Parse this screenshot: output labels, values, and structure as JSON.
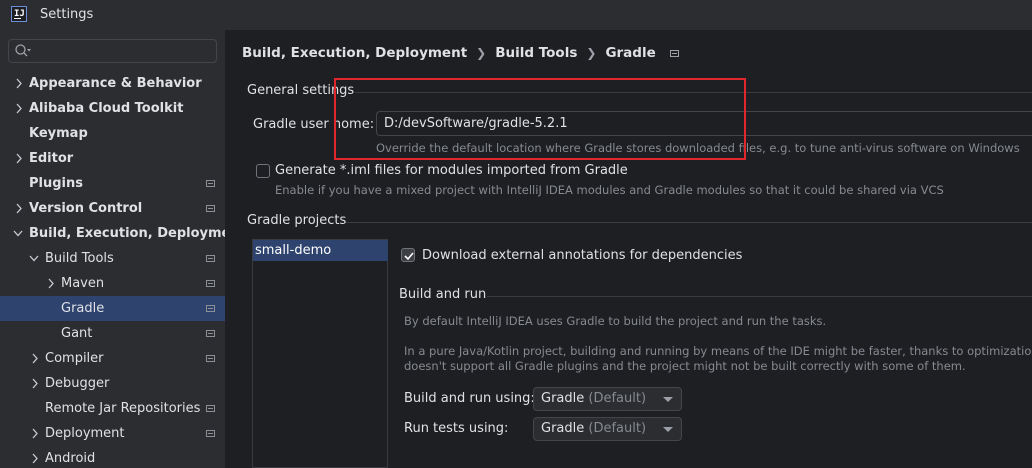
{
  "window": {
    "logo_text": "IJ",
    "title": "Settings"
  },
  "sidebar": {
    "search_placeholder": "",
    "items": [
      {
        "label": "Appearance & Behavior"
      },
      {
        "label": "Alibaba Cloud Toolkit"
      },
      {
        "label": "Keymap"
      },
      {
        "label": "Editor"
      },
      {
        "label": "Plugins"
      },
      {
        "label": "Version Control"
      },
      {
        "label": "Build, Execution, Deployment"
      },
      {
        "label": "Build Tools"
      },
      {
        "label": "Maven"
      },
      {
        "label": "Gradle"
      },
      {
        "label": "Gant"
      },
      {
        "label": "Compiler"
      },
      {
        "label": "Debugger"
      },
      {
        "label": "Remote Jar Repositories"
      },
      {
        "label": "Deployment"
      },
      {
        "label": "Android"
      }
    ]
  },
  "breadcrumb": {
    "items": [
      "Build, Execution, Deployment",
      "Build Tools",
      "Gradle"
    ]
  },
  "general": {
    "title": "General settings",
    "user_home_label": "Gradle user home:",
    "user_home_value": "D:/devSoftware/gradle-5.2.1",
    "user_home_hint": "Override the default location where Gradle stores downloaded files, e.g. to tune anti-virus software on Windows",
    "generate_iml_label": "Generate *.iml files for modules imported from Gradle",
    "generate_iml_checked": false,
    "generate_iml_hint": "Enable if you have a mixed project with IntelliJ IDEA modules and Gradle modules so that it could be shared via VCS"
  },
  "projects": {
    "title": "Gradle projects",
    "list": [
      "small-demo"
    ],
    "download_annotations_label": "Download external annotations for dependencies",
    "download_annotations_checked": true
  },
  "build_and_run": {
    "title": "Build and run",
    "desc1": "By default IntelliJ IDEA uses Gradle to build the project and run the tasks.",
    "desc2_line1": "In a pure Java/Kotlin project, building and running by means of the IDE might be faster, thanks to optimizations. Note, tha",
    "desc2_line2": "doesn't support all Gradle plugins and the project might not be built correctly with some of them.",
    "build_run_using_label": "Build and run using:",
    "build_run_using_value": "Gradle",
    "build_run_using_sub": "(Default)",
    "run_tests_using_label": "Run tests using:",
    "run_tests_using_value": "Gradle",
    "run_tests_using_sub": "(Default)"
  },
  "colors": {
    "accent_selection": "#2e436e",
    "highlight_box": "#e1262e"
  }
}
